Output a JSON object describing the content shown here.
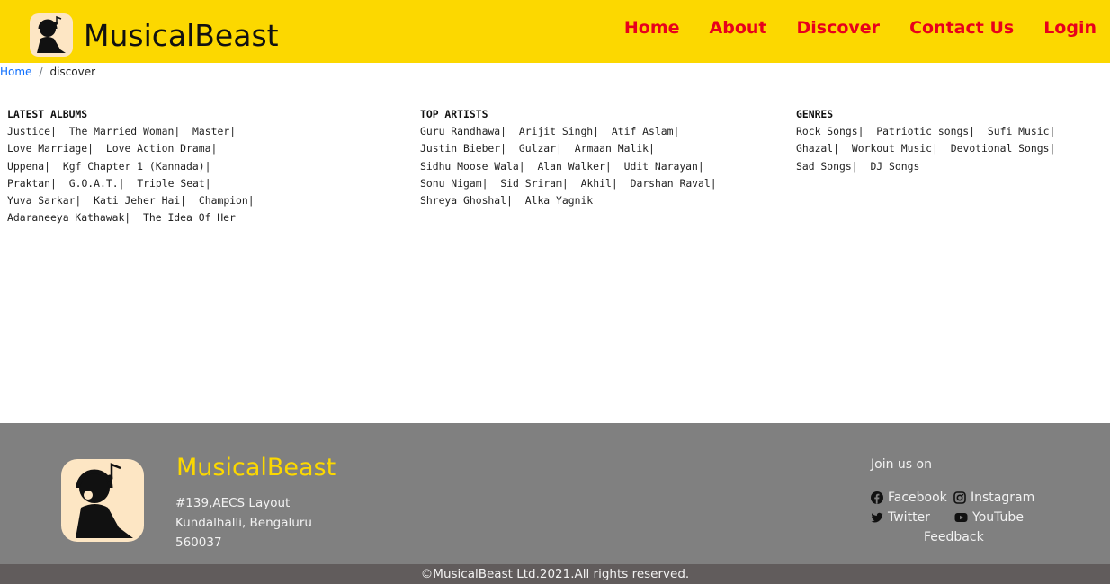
{
  "header": {
    "brand": "MusicalBeast",
    "nav": [
      "Home",
      "About",
      "Discover",
      "Contact Us",
      "Login"
    ]
  },
  "breadcrumb": {
    "home": "Home",
    "separator": "/",
    "current": "discover"
  },
  "latest_albums": {
    "title": "LATEST ALBUMS",
    "rows": [
      [
        "Justice|",
        "The Married Woman|",
        "Master|"
      ],
      [
        "Love Marriage|",
        "Love Action Drama|"
      ],
      [
        "Uppena|",
        "Kgf Chapter 1 (Kannada)|"
      ],
      [
        "Praktan|",
        "G.O.A.T.|",
        "Triple Seat|"
      ],
      [
        "Yuva Sarkar|",
        "Kati Jeher Hai|",
        "Champion|"
      ],
      [
        "Adaraneeya Kathawak|",
        "The Idea Of Her"
      ]
    ]
  },
  "top_artists": {
    "title": "TOP ARTISTS",
    "rows": [
      [
        "Guru Randhawa|",
        "Arijit Singh|",
        "Atif Aslam|"
      ],
      [
        "Justin Bieber|",
        "Gulzar|",
        "Armaan Malik|"
      ],
      [
        "Sidhu Moose Wala|",
        "Alan Walker|",
        "Udit Narayan|"
      ],
      [
        "Sonu Nigam|",
        "Sid Sriram|",
        "Akhil|",
        "Darshan Raval|"
      ],
      [
        "Shreya Ghoshal|",
        "Alka Yagnik"
      ]
    ]
  },
  "genres": {
    "title": "GENRES",
    "rows": [
      [
        "Rock Songs|",
        "Patriotic songs|",
        "Sufi Music|"
      ],
      [
        "Ghazal|",
        "Workout Music|",
        "Devotional Songs|"
      ],
      [
        "Sad Songs|",
        "DJ Songs"
      ]
    ]
  },
  "footer": {
    "brand": "MusicalBeast",
    "address": [
      "#139,AECS Layout",
      "Kundalhalli, Bengaluru",
      "560037"
    ],
    "join_label": "Join us on",
    "social": {
      "facebook": "Facebook",
      "instagram": "Instagram",
      "twitter": "Twitter",
      "youtube": "YouTube"
    },
    "feedback": "Feedback",
    "copyright": "©MusicalBeast Ltd.2021.All rights reserved."
  },
  "colors": {
    "header_bg": "#fcd800",
    "nav_link": "#e8001c",
    "footer_bg": "#808080",
    "copyright_bg": "#615c5c",
    "footer_brand": "#fcd800"
  },
  "icons": {
    "logo": "headphone-listener-logo-icon",
    "facebook": "facebook-icon",
    "instagram": "instagram-icon",
    "twitter": "twitter-icon",
    "youtube": "youtube-icon"
  }
}
